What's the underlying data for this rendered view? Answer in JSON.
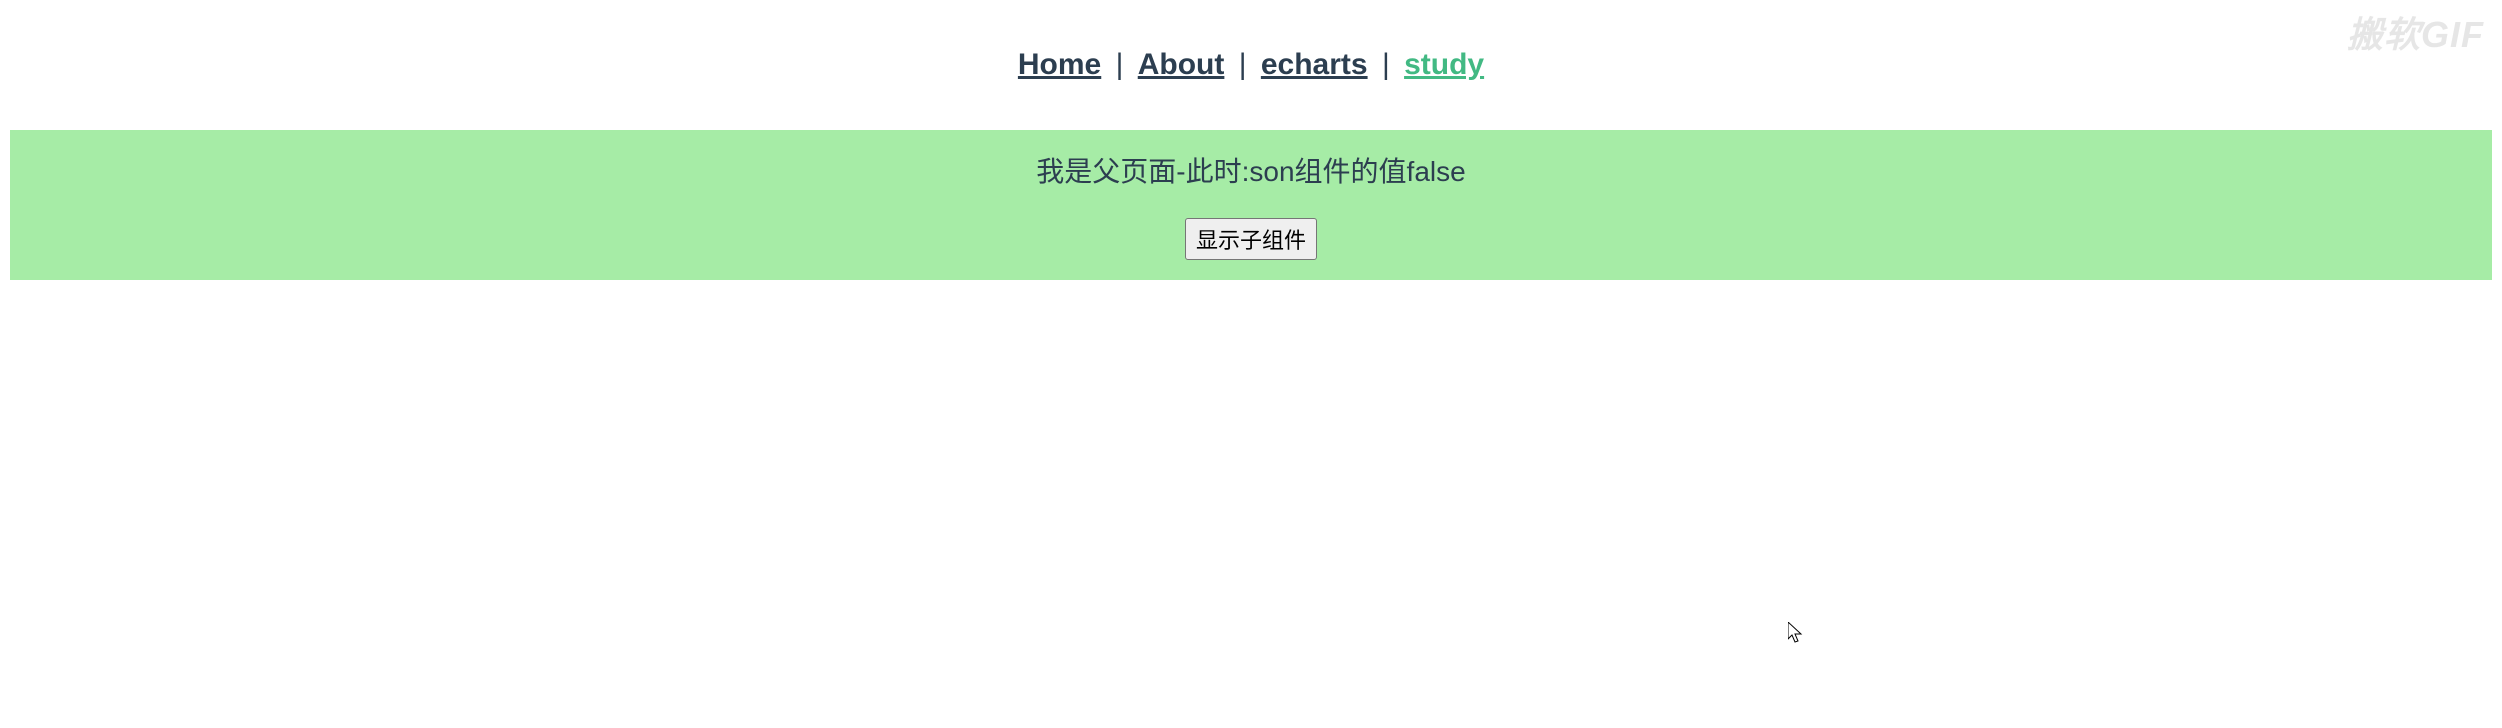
{
  "nav": {
    "items": [
      {
        "label": "Home",
        "active": false
      },
      {
        "label": "About",
        "active": false
      },
      {
        "label": "echarts",
        "active": false
      },
      {
        "label": "study",
        "active": true
      }
    ],
    "separator": " | "
  },
  "panel": {
    "title": "我是父页面-此时:son组件的值false",
    "button_label": "显示子组件"
  },
  "watermark": "搬软GIF"
}
